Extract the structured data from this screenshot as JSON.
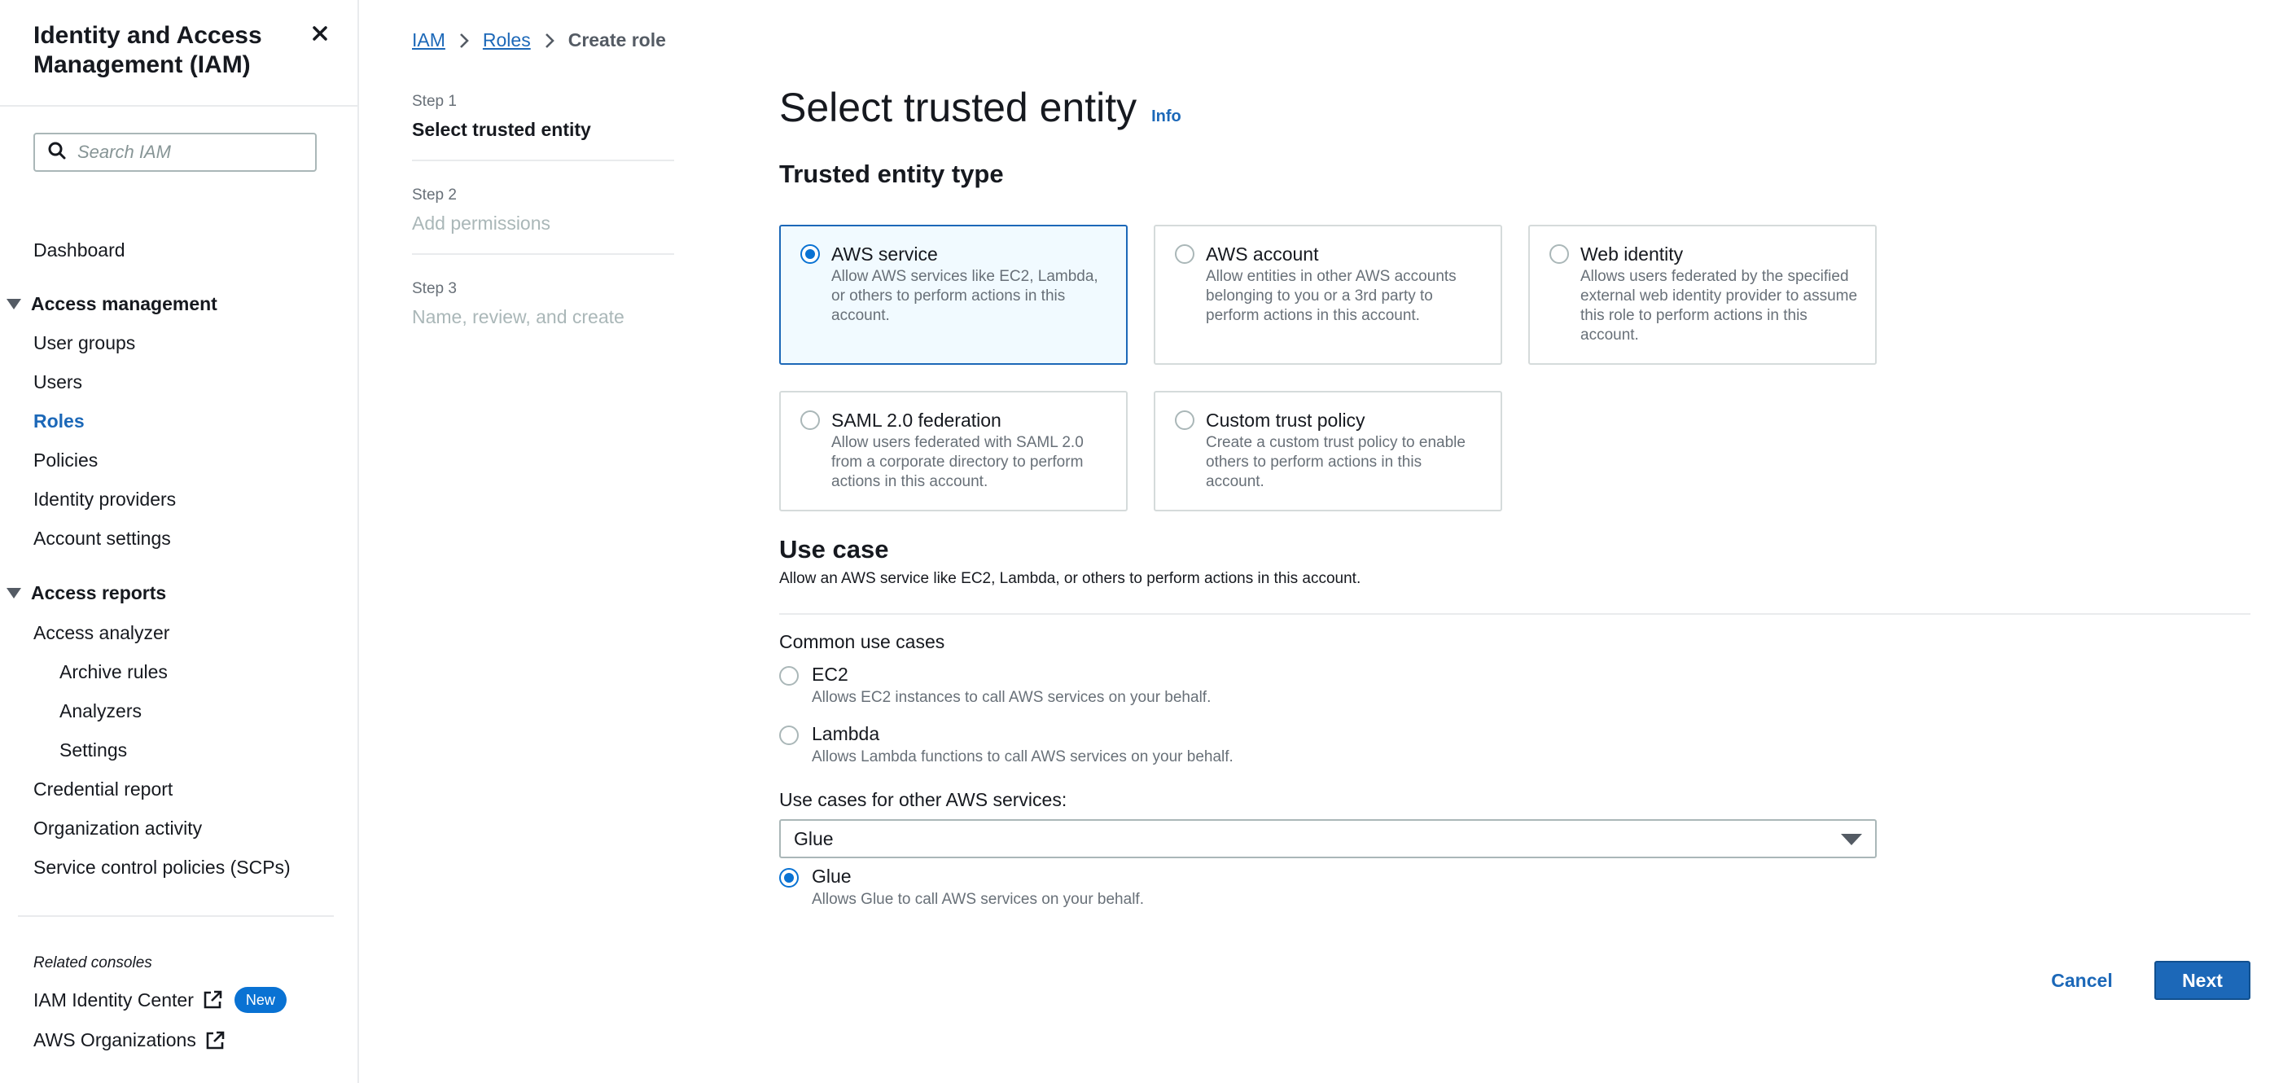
{
  "sidebar": {
    "title": "Identity and Access Management (IAM)",
    "search_placeholder": "Search IAM",
    "dashboard": "Dashboard",
    "access_management": {
      "label": "Access management",
      "items": [
        "User groups",
        "Users",
        "Roles",
        "Policies",
        "Identity providers",
        "Account settings"
      ],
      "active": "Roles"
    },
    "access_reports": {
      "label": "Access reports",
      "analyzer": "Access analyzer",
      "analyzer_children": [
        "Archive rules",
        "Analyzers",
        "Settings"
      ],
      "items": [
        "Credential report",
        "Organization activity",
        "Service control policies (SCPs)"
      ]
    },
    "related_consoles_label": "Related consoles",
    "related": [
      {
        "label": "IAM Identity Center",
        "badge": "New"
      },
      {
        "label": "AWS Organizations"
      }
    ]
  },
  "breadcrumb": [
    "IAM",
    "Roles",
    "Create role"
  ],
  "steps": [
    {
      "num": "Step 1",
      "label": "Select trusted entity"
    },
    {
      "num": "Step 2",
      "label": "Add permissions"
    },
    {
      "num": "Step 3",
      "label": "Name, review, and create"
    }
  ],
  "page": {
    "title": "Select trusted entity",
    "info": "Info"
  },
  "trusted_entity": {
    "heading": "Trusted entity type",
    "options": [
      {
        "title": "AWS service",
        "desc": "Allow AWS services like EC2, Lambda, or others to perform actions in this account.",
        "selected": true
      },
      {
        "title": "AWS account",
        "desc": "Allow entities in other AWS accounts belonging to you or a 3rd party to perform actions in this account.",
        "selected": false
      },
      {
        "title": "Web identity",
        "desc": "Allows users federated by the specified external web identity provider to assume this role to perform actions in this account.",
        "selected": false
      },
      {
        "title": "SAML 2.0 federation",
        "desc": "Allow users federated with SAML 2.0 from a corporate directory to perform actions in this account.",
        "selected": false
      },
      {
        "title": "Custom trust policy",
        "desc": "Create a custom trust policy to enable others to perform actions in this account.",
        "selected": false
      }
    ]
  },
  "use_case": {
    "heading": "Use case",
    "desc": "Allow an AWS service like EC2, Lambda, or others to perform actions in this account.",
    "common_label": "Common use cases",
    "common": [
      {
        "title": "EC2",
        "desc": "Allows EC2 instances to call AWS services on your behalf."
      },
      {
        "title": "Lambda",
        "desc": "Allows Lambda functions to call AWS services on your behalf."
      }
    ],
    "other_label": "Use cases for other AWS services:",
    "select_value": "Glue",
    "selected_option": {
      "title": "Glue",
      "desc": "Allows Glue to call AWS services on your behalf."
    }
  },
  "actions": {
    "cancel": "Cancel",
    "next": "Next"
  },
  "colors": {
    "accent": "#1c68b8",
    "selected_bg": "#f1faff",
    "radio": "#0972d3"
  }
}
